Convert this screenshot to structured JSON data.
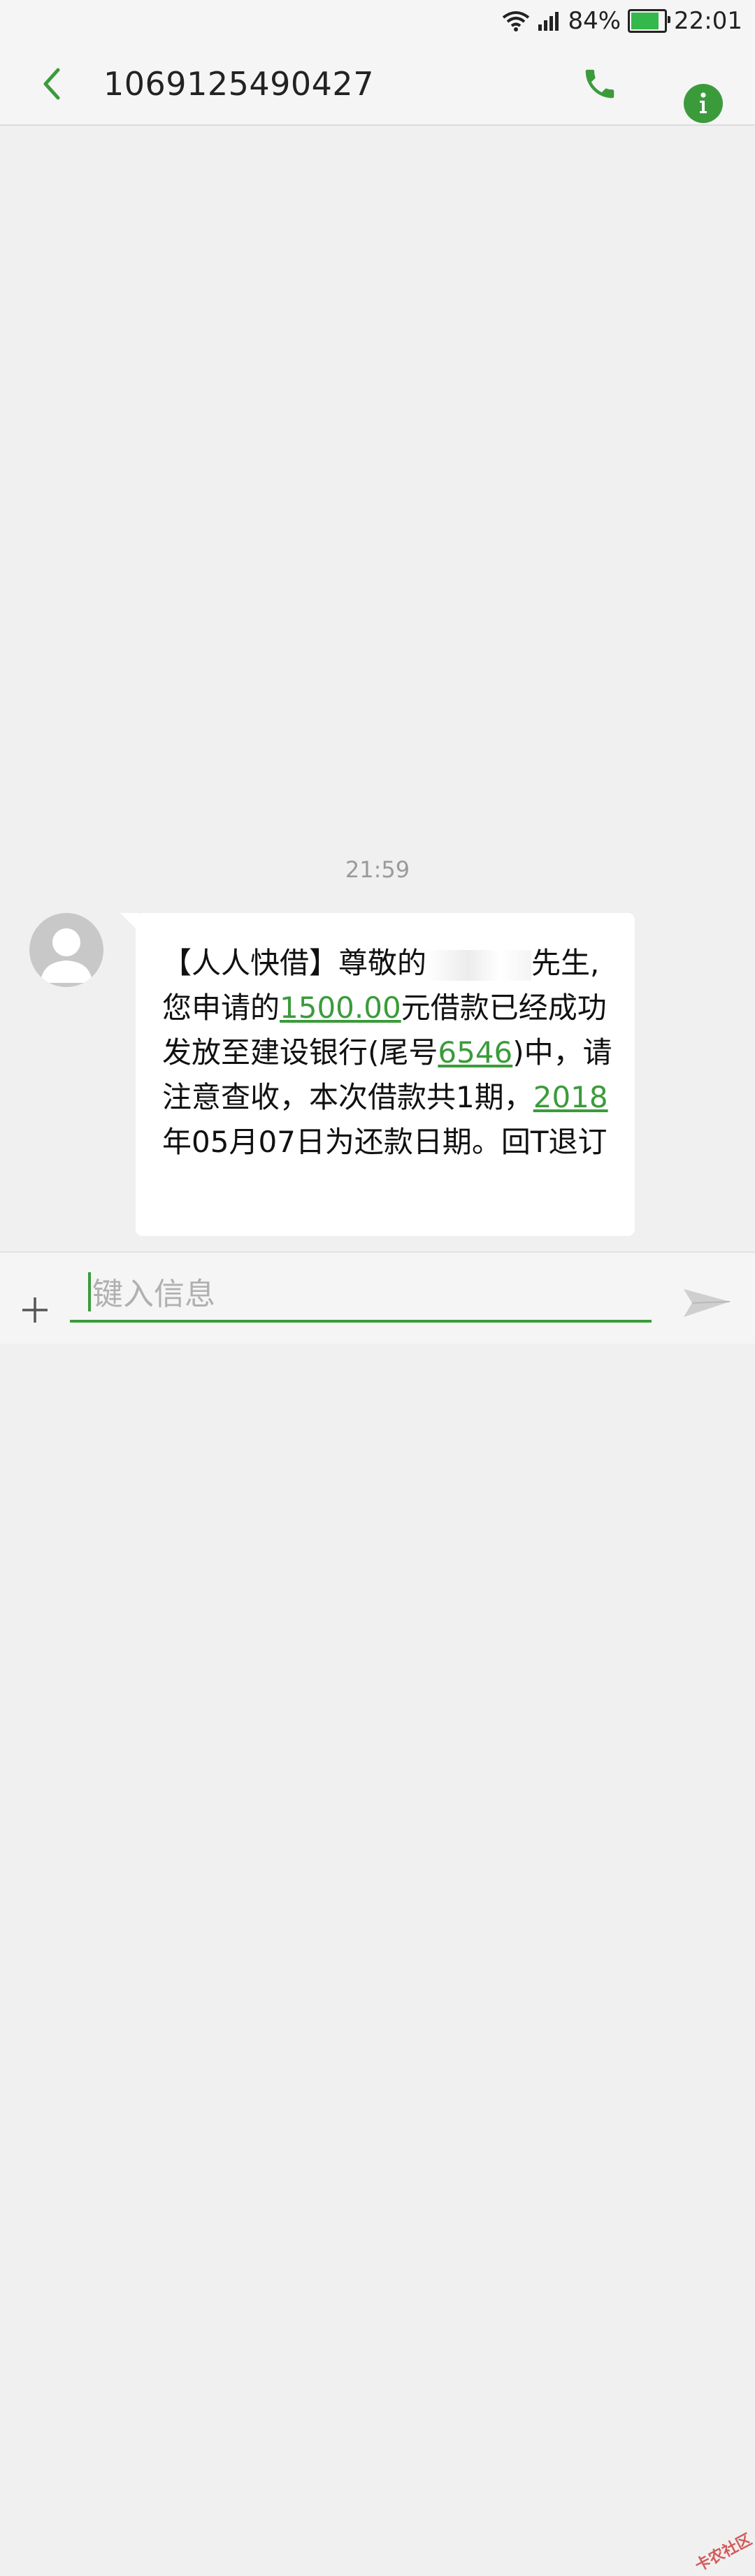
{
  "status_bar": {
    "battery_percent": "84%",
    "battery_level": 0.84,
    "time": "22:01",
    "icons": [
      "wifi-icon",
      "signal-icon",
      "battery-icon"
    ]
  },
  "toolbar": {
    "title": "1069125490427",
    "back_icon": "chevron-left-icon",
    "call_icon": "phone-icon",
    "info_icon": "info-icon"
  },
  "conversation": {
    "timestamp": "21:59",
    "message": {
      "part1": "【人人快借】尊敬的",
      "part2": "先生,您申请的",
      "amount": "1500.00",
      "part3": "元借款已经成功发放至建设银行(尾号",
      "card_tail": "6546",
      "part4": ")中，请注意查收，本次借款共1期，",
      "year": "2018",
      "part5": "年05月07日为还款日期。回T退订"
    }
  },
  "composer": {
    "placeholder": "键入信息",
    "add_icon": "plus-icon",
    "send_icon": "send-icon"
  },
  "watermark": {
    "text": "卡农社区"
  },
  "colors": {
    "accent": "#3b9b3b",
    "background": "#f0f0f0",
    "bubble": "#ffffff"
  }
}
